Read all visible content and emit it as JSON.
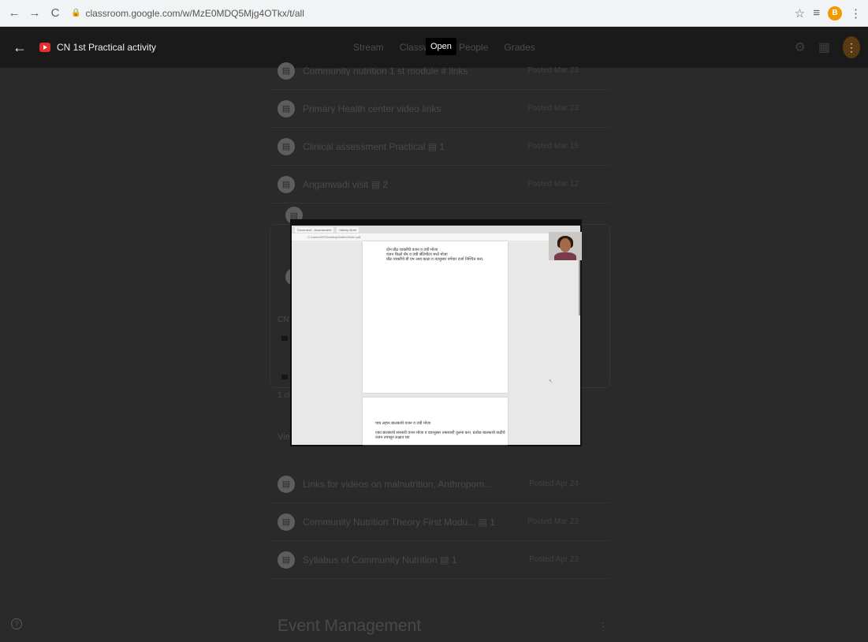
{
  "browser": {
    "url": "classroom.google.com/w/MzE0MDQ5Mjg4OTkx/t/all",
    "profile_letter": "B"
  },
  "header": {
    "class_title": "CN 1st Practical activity",
    "tabs": [
      "Stream",
      "Classwork",
      "People",
      "Grades"
    ],
    "open_badge": "Open"
  },
  "posts": [
    {
      "title": "Community nutrition 1 st module # links",
      "date": "Posted Mar 23"
    },
    {
      "title": "Primary Health center video links",
      "date": "Posted Mar 23"
    },
    {
      "title": "Clinical assessment Practical",
      "date": "Posted Mar 15",
      "count": "1"
    },
    {
      "title": "Anganwadi visit",
      "date": "Posted Mar 12",
      "count": "2"
    },
    {
      "title": "Links for videos on malnutrition, Anthropom...",
      "date": "Posted Apr 24"
    },
    {
      "title": "Community Nutrition Theory First Modu...",
      "date": "Posted Mar 23",
      "count": "1"
    },
    {
      "title": "Syllabus of Community Nutrition",
      "date": "Posted Apr 23",
      "count": "1"
    }
  ],
  "card": {
    "label_cn": "CN 1",
    "label_count": "1 cl",
    "label_view": "View"
  },
  "section": {
    "title": "Event Management"
  },
  "share": {
    "url": "C:/Users/HP/Desktop/Anthro/Nutri.pdf",
    "tab1": "Document - Assessment",
    "tab2": "history-Nutri",
    "page1_lines": [
      "दोन प्रौढ व्यक्तींचे वजन व उंची मोजा",
      "वजन किलो ग्रॅम व उंची सेंटिमीटर मध्ये मोजा",
      "प्रौढ व्यक्तींचे बी एम आय काढा व त्यानुसार वर्गवार दर्जा निश्चित करा."
    ],
    "page2_lines": [
      "पाच लहान बालकांचे वजन व उंची मोजा",
      "एका बालकाचे सरासरी वजन मोजा व वयानुसार तक्त्याशी तुलना करा. प्रत्येक बालकाचे वाढीचे",
      "वजन तपासून लक्षात घ्या"
    ]
  },
  "colors": {
    "youtube_red": "#e3302f",
    "profile_orange": "#f29900"
  }
}
